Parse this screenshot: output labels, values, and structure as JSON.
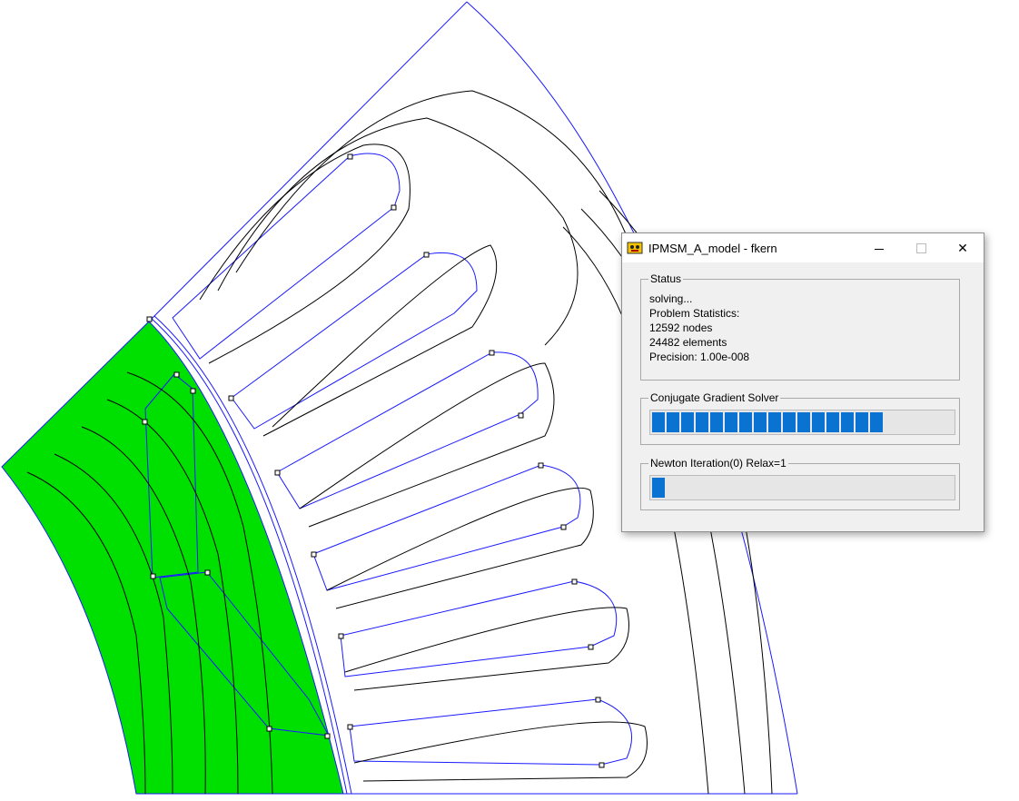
{
  "window": {
    "title": "IPMSM_A_model - fkern",
    "controls": {
      "minimize": "minimize",
      "maximize": "maximize",
      "close": "✕"
    }
  },
  "status": {
    "label": "Status",
    "state": "solving...",
    "stats_heading": "Problem Statistics:",
    "nodes": "12592 nodes",
    "elements": "24482 elements",
    "precision": "Precision: 1.00e-008"
  },
  "cg_solver": {
    "label": "Conjugate Gradient Solver",
    "progress": 0.78,
    "blocks": 16
  },
  "newton": {
    "label": "Newton Iteration(0) Relax=1",
    "progress": 0.05,
    "blocks": 1
  },
  "colors": {
    "rotor_fill": "#00e000",
    "geometry_line": "#1a1aff",
    "flux_line": "#000000",
    "progress_block": "#0a73d1"
  },
  "icons": {
    "app": "femm-app-icon",
    "node_marker": "node-square-icon"
  }
}
